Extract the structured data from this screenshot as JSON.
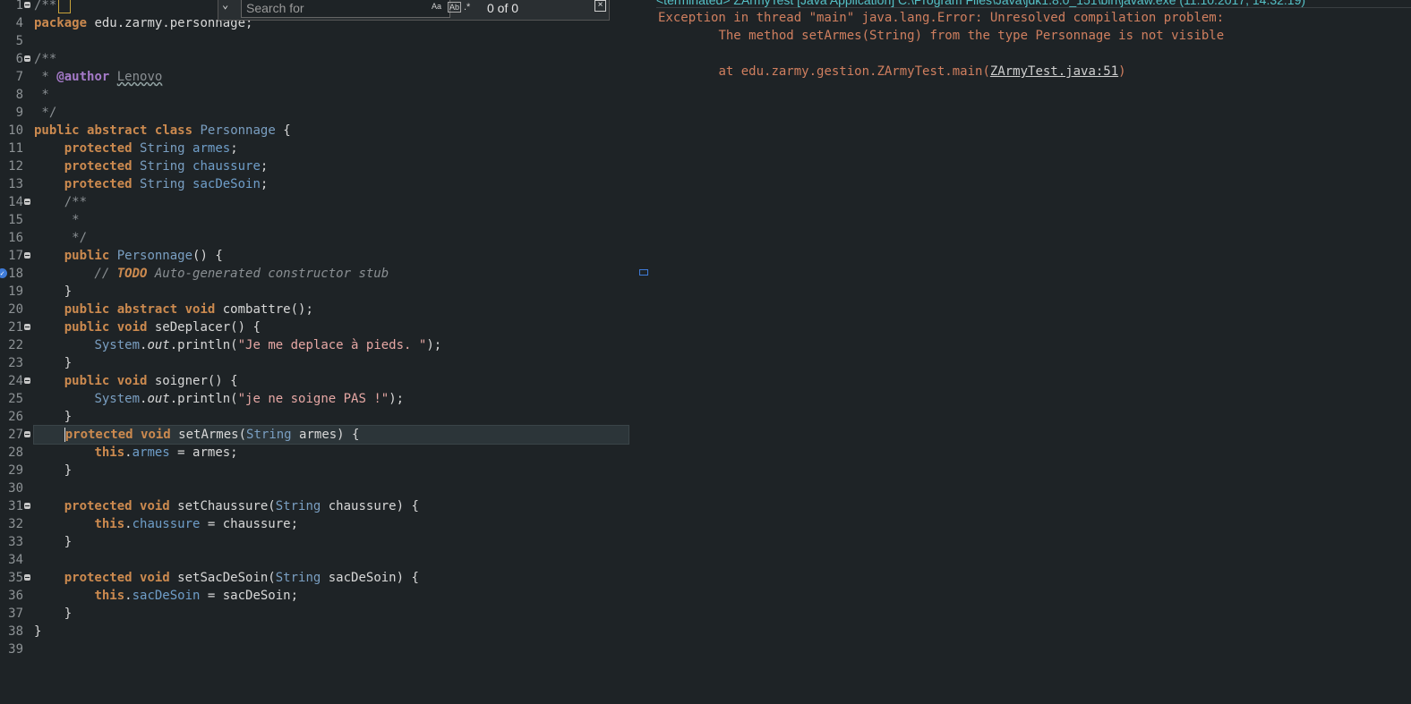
{
  "find_bar": {
    "placeholder": "Search for",
    "match_case_icon": "Aa",
    "whole_word_icon": "Ab",
    "regex_icon": ".*",
    "count": "0 of 0",
    "close_icon": "⊠"
  },
  "editor": {
    "lines": [
      {
        "n": "1",
        "t": "/**"
      },
      {
        "n": "4",
        "t": "package edu.zarmy.personnage;"
      },
      {
        "n": "5",
        "t": ""
      },
      {
        "n": "6",
        "t": "/**"
      },
      {
        "n": "7",
        "t": " * @author Lenovo"
      },
      {
        "n": "8",
        "t": " *"
      },
      {
        "n": "9",
        "t": " */"
      },
      {
        "n": "10",
        "t": "public abstract class Personnage {"
      },
      {
        "n": "11",
        "t": "    protected String armes;"
      },
      {
        "n": "12",
        "t": "    protected String chaussure;"
      },
      {
        "n": "13",
        "t": "    protected String sacDeSoin;"
      },
      {
        "n": "14",
        "t": "    /**"
      },
      {
        "n": "15",
        "t": "     *"
      },
      {
        "n": "16",
        "t": "     */"
      },
      {
        "n": "17",
        "t": "    public Personnage() {"
      },
      {
        "n": "18",
        "t": "        // TODO Auto-generated constructor stub"
      },
      {
        "n": "19",
        "t": "    }"
      },
      {
        "n": "20",
        "t": "    public abstract void combattre();"
      },
      {
        "n": "21",
        "t": "    public void seDeplacer() {"
      },
      {
        "n": "22",
        "t": "        System.out.println(\"Je me deplace à pieds. \");"
      },
      {
        "n": "23",
        "t": "    }"
      },
      {
        "n": "24",
        "t": "    public void soigner() {"
      },
      {
        "n": "25",
        "t": "        System.out.println(\"je ne soigne PAS !\");"
      },
      {
        "n": "26",
        "t": "    }"
      },
      {
        "n": "27",
        "t": "    protected void setArmes(String armes) {"
      },
      {
        "n": "28",
        "t": "        this.armes = armes;"
      },
      {
        "n": "29",
        "t": "    }"
      },
      {
        "n": "30",
        "t": ""
      },
      {
        "n": "31",
        "t": "    protected void setChaussure(String chaussure) {"
      },
      {
        "n": "32",
        "t": "        this.chaussure = chaussure;"
      },
      {
        "n": "33",
        "t": "    }"
      },
      {
        "n": "34",
        "t": ""
      },
      {
        "n": "35",
        "t": "    protected void setSacDeSoin(String sacDeSoin) {"
      },
      {
        "n": "36",
        "t": "        this.sacDeSoin = sacDeSoin;"
      },
      {
        "n": "37",
        "t": "    }"
      },
      {
        "n": "38",
        "t": "}"
      },
      {
        "n": "39",
        "t": ""
      }
    ]
  },
  "console": {
    "header": "<terminated> ZArmyTest [Java Application] C:\\Program Files\\Java\\jdk1.8.0_151\\bin\\javaw.exe (11.10.2017, 14:32:19)",
    "error_line1": "Exception in thread \"main\" java.lang.Error: Unresolved compilation problem: ",
    "error_line2": "\tThe method setArmes(String) from the type Personnage is not visible",
    "error_line3_prefix": "\tat edu.zarmy.gestion.ZArmyTest.main(",
    "error_line3_link": "ZArmyTest.java:51",
    "error_line3_suffix": ")"
  },
  "colors": {
    "background": "#1e2326",
    "keyword": "#cc8a4f",
    "type": "#7a9fc2",
    "string": "#e6a7a4",
    "comment": "#8a8f93",
    "console_error": "#d07f5f"
  }
}
